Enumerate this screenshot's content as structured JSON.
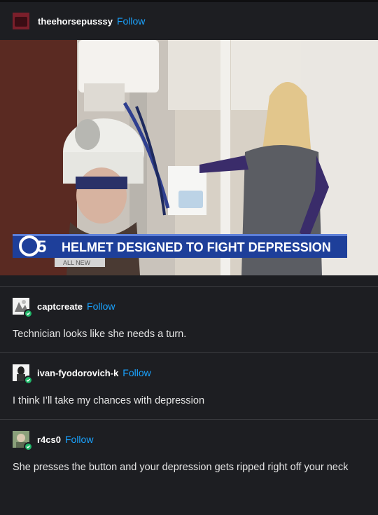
{
  "post": {
    "username": "theehorsepusssy",
    "follow_label": "Follow",
    "image": {
      "description_icon": "news-broadcast-image",
      "chyron_channel": "5",
      "chyron_headline": "HELMET DESIGNED TO FIGHT DEPRESSION",
      "chyron_subtag": "ALL NEW"
    }
  },
  "replies": [
    {
      "username": "captcreate",
      "follow_label": "Follow",
      "text": "Technician looks like she needs a turn."
    },
    {
      "username": "ivan-fyodorovich-k",
      "follow_label": "Follow",
      "text": "I think I’ll take my chances with depression"
    },
    {
      "username": "r4cs0",
      "follow_label": "Follow",
      "text": "She presses the button and your depression gets ripped right off your neck"
    }
  ],
  "colors": {
    "background": "#1d1e22",
    "follow_link": "#1aa3ff",
    "reblog_badge": "#21b86a",
    "chyron_blue": "#1e3f9a"
  }
}
